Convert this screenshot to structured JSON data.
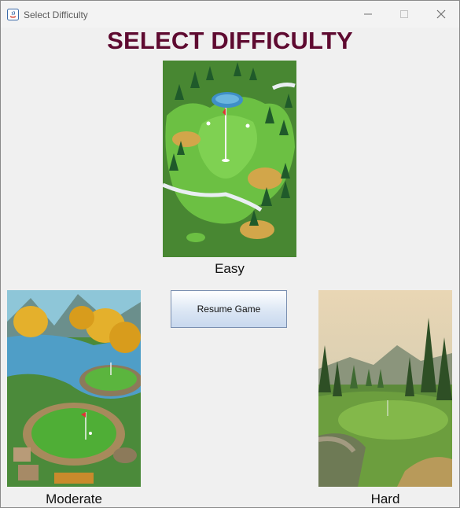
{
  "window": {
    "title": "Select Difficulty"
  },
  "heading": "SELECT DIFFICULTY",
  "difficulties": {
    "easy": {
      "label": "Easy"
    },
    "moderate": {
      "label": "Moderate"
    },
    "hard": {
      "label": "Hard"
    }
  },
  "resume_button": {
    "label": "Resume Game"
  },
  "colors": {
    "heading": "#5e0a30"
  }
}
